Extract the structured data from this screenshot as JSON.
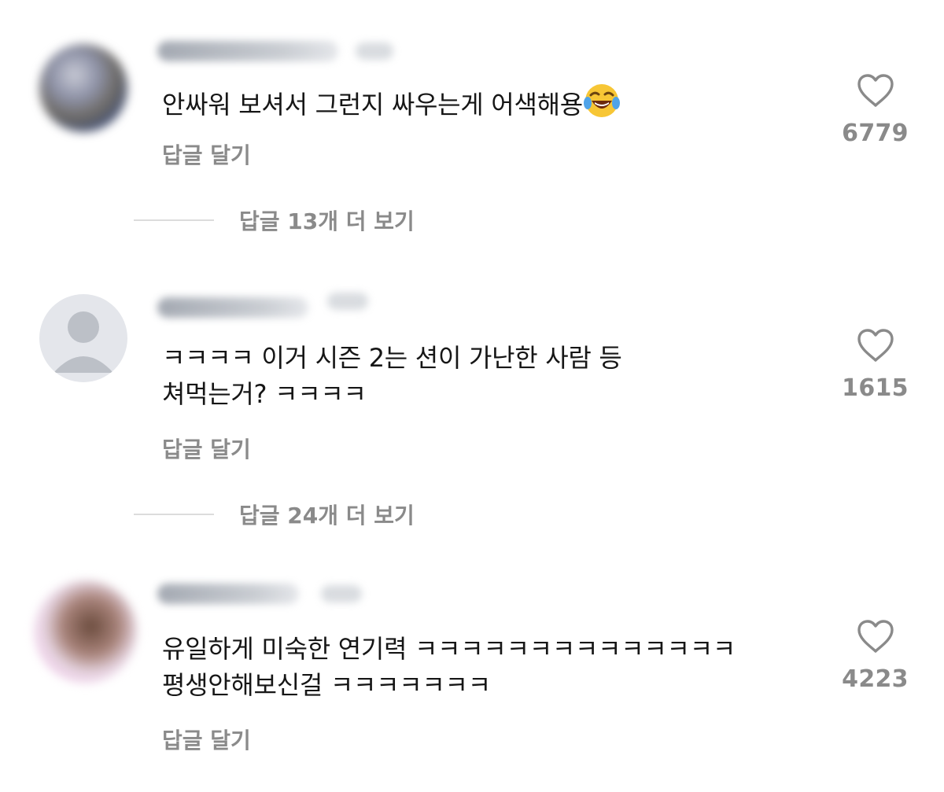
{
  "comments": [
    {
      "text_lines": [
        "안싸워 보셔서 그런지 싸우는게 어색해용"
      ],
      "emoji": "face-with-tears-of-joy",
      "reply_label": "답글 달기",
      "likes": "6779",
      "more_replies_label": "답글 13개 더 보기"
    },
    {
      "text_lines": [
        "ㅋㅋㅋㅋ 이거 시즌 2는 션이 가난한 사람 등",
        "쳐먹는거? ㅋㅋㅋㅋ"
      ],
      "reply_label": "답글 달기",
      "likes": "1615",
      "more_replies_label": "답글 24개 더 보기"
    },
    {
      "text_lines": [
        "유일하게 미숙한 연기력 ㅋㅋㅋㅋㅋㅋㅋㅋㅋㅋㅋㅋㅋㅋ",
        "평생안해보신걸 ㅋㅋㅋㅋㅋㅋㅋ"
      ],
      "reply_label": "답글 달기",
      "likes": "4223"
    }
  ],
  "colors": {
    "text": "#161616",
    "muted": "#8a8a8a",
    "divider": "#dcdcdc",
    "default_avatar_bg": "#e4e6eb",
    "default_avatar_fg": "#bcc0c7"
  }
}
